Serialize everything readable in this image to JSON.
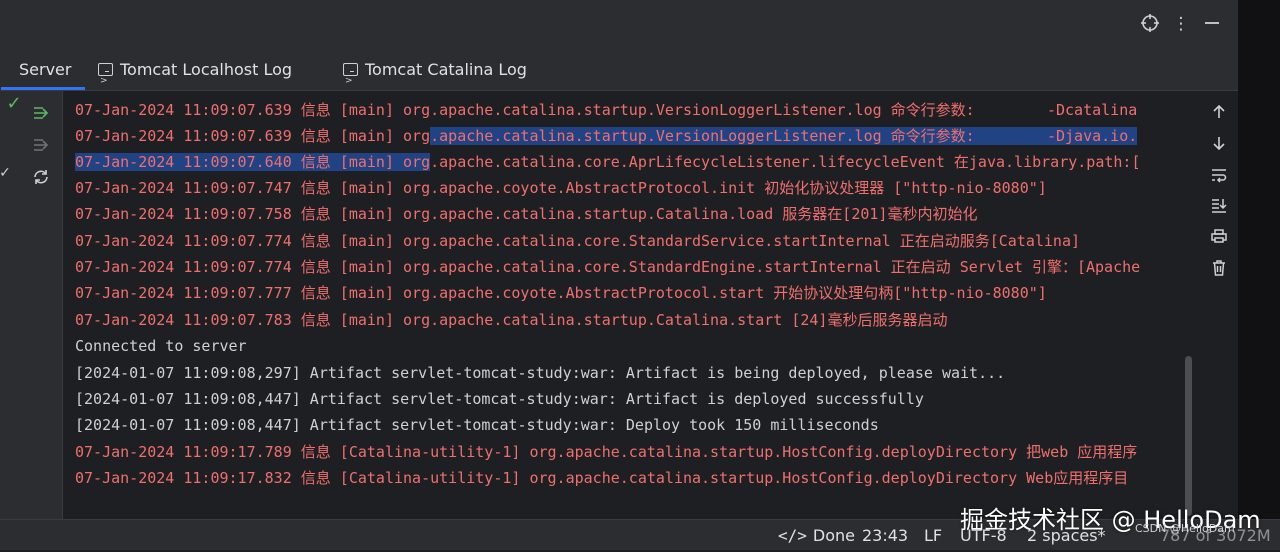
{
  "tabs": [
    {
      "label": "Server"
    },
    {
      "label": "Tomcat Localhost Log"
    },
    {
      "label": "Tomcat Catalina Log"
    }
  ],
  "console": {
    "lines": [
      {
        "pre": "07-Jan-2024 11:09:07.639 信息 [main] org.apache.catalina.startup.VersionLoggerListener.log 命令行参数:        -Dcatalina",
        "hl": "",
        "post": ""
      },
      {
        "pre": "07-Jan-2024 11:09:07.639 信息 [main] org",
        "hl": ".apache.catalina.startup.VersionLoggerListener.log 命令行参数:        -Djava.io.",
        "post": ""
      },
      {
        "pre": "",
        "hl": "07-Jan-2024 11:09:07.640 信息 [main] org",
        "post": ".apache.catalina.core.AprLifecycleListener.lifecycleEvent 在java.library.path:["
      },
      {
        "pre": "07-Jan-2024 11:09:07.747 信息 [main] org.apache.coyote.AbstractProtocol.init 初始化协议处理器 [\"http-nio-8080\"]",
        "hl": "",
        "post": ""
      },
      {
        "pre": "07-Jan-2024 11:09:07.758 信息 [main] org.apache.catalina.startup.Catalina.load 服务器在[201]毫秒内初始化",
        "hl": "",
        "post": ""
      },
      {
        "pre": "07-Jan-2024 11:09:07.774 信息 [main] org.apache.catalina.core.StandardService.startInternal 正在启动服务[Catalina]",
        "hl": "",
        "post": ""
      },
      {
        "pre": "07-Jan-2024 11:09:07.774 信息 [main] org.apache.catalina.core.StandardEngine.startInternal 正在启动 Servlet 引擎：[Apache",
        "hl": "",
        "post": ""
      },
      {
        "pre": "07-Jan-2024 11:09:07.777 信息 [main] org.apache.coyote.AbstractProtocol.start 开始协议处理句柄[\"http-nio-8080\"]",
        "hl": "",
        "post": ""
      },
      {
        "pre": "07-Jan-2024 11:09:07.783 信息 [main] org.apache.catalina.startup.Catalina.start [24]毫秒后服务器启动",
        "hl": "",
        "post": ""
      },
      {
        "pre": "Connected to server",
        "hl": "",
        "post": ""
      },
      {
        "pre": "[2024-01-07 11:09:08,297] Artifact servlet-tomcat-study:war: Artifact is being deployed, please wait...",
        "hl": "",
        "post": ""
      },
      {
        "pre": "[2024-01-07 11:09:08,447] Artifact servlet-tomcat-study:war: Artifact is deployed successfully",
        "hl": "",
        "post": ""
      },
      {
        "pre": "[2024-01-07 11:09:08,447] Artifact servlet-tomcat-study:war: Deploy took 150 milliseconds",
        "hl": "",
        "post": ""
      },
      {
        "pre": "07-Jan-2024 11:09:17.789 信息 [Catalina-utility-1] org.apache.catalina.startup.HostConfig.deployDirectory 把web 应用程序",
        "hl": "",
        "post": ""
      },
      {
        "pre": "07-Jan-2024 11:09:17.832 信息 [Catalina-utility-1] org.apache.catalina.startup.HostConfig.deployDirectory Web应用程序目",
        "hl": "",
        "post": ""
      }
    ]
  },
  "status": {
    "done": "Done",
    "position": "23:43",
    "line_sep": "LF",
    "encoding": "UTF-8",
    "indent": "2 spaces*",
    "memory": "787 of 3072M"
  },
  "watermark": {
    "text": "掘金技术社区 @ HelloDam",
    "small": "CSDN @HelloDam"
  },
  "colors": {
    "log_red": "#ef6f6f",
    "log_white": "#cdd0d6",
    "selection": "#214283",
    "accent": "#3574f0",
    "check": "#5fb865",
    "deploy": "#5fb865"
  },
  "icons": [
    "target-icon",
    "more-vertical-icon",
    "minimize-icon",
    "terminal-icon",
    "checkmark-icon",
    "deploy-icon",
    "undeploy-icon",
    "refresh-icon",
    "scroll-up-icon",
    "scroll-down-icon",
    "soft-wrap-icon",
    "scroll-to-end-icon",
    "print-icon",
    "trash-icon",
    "code-icon"
  ]
}
